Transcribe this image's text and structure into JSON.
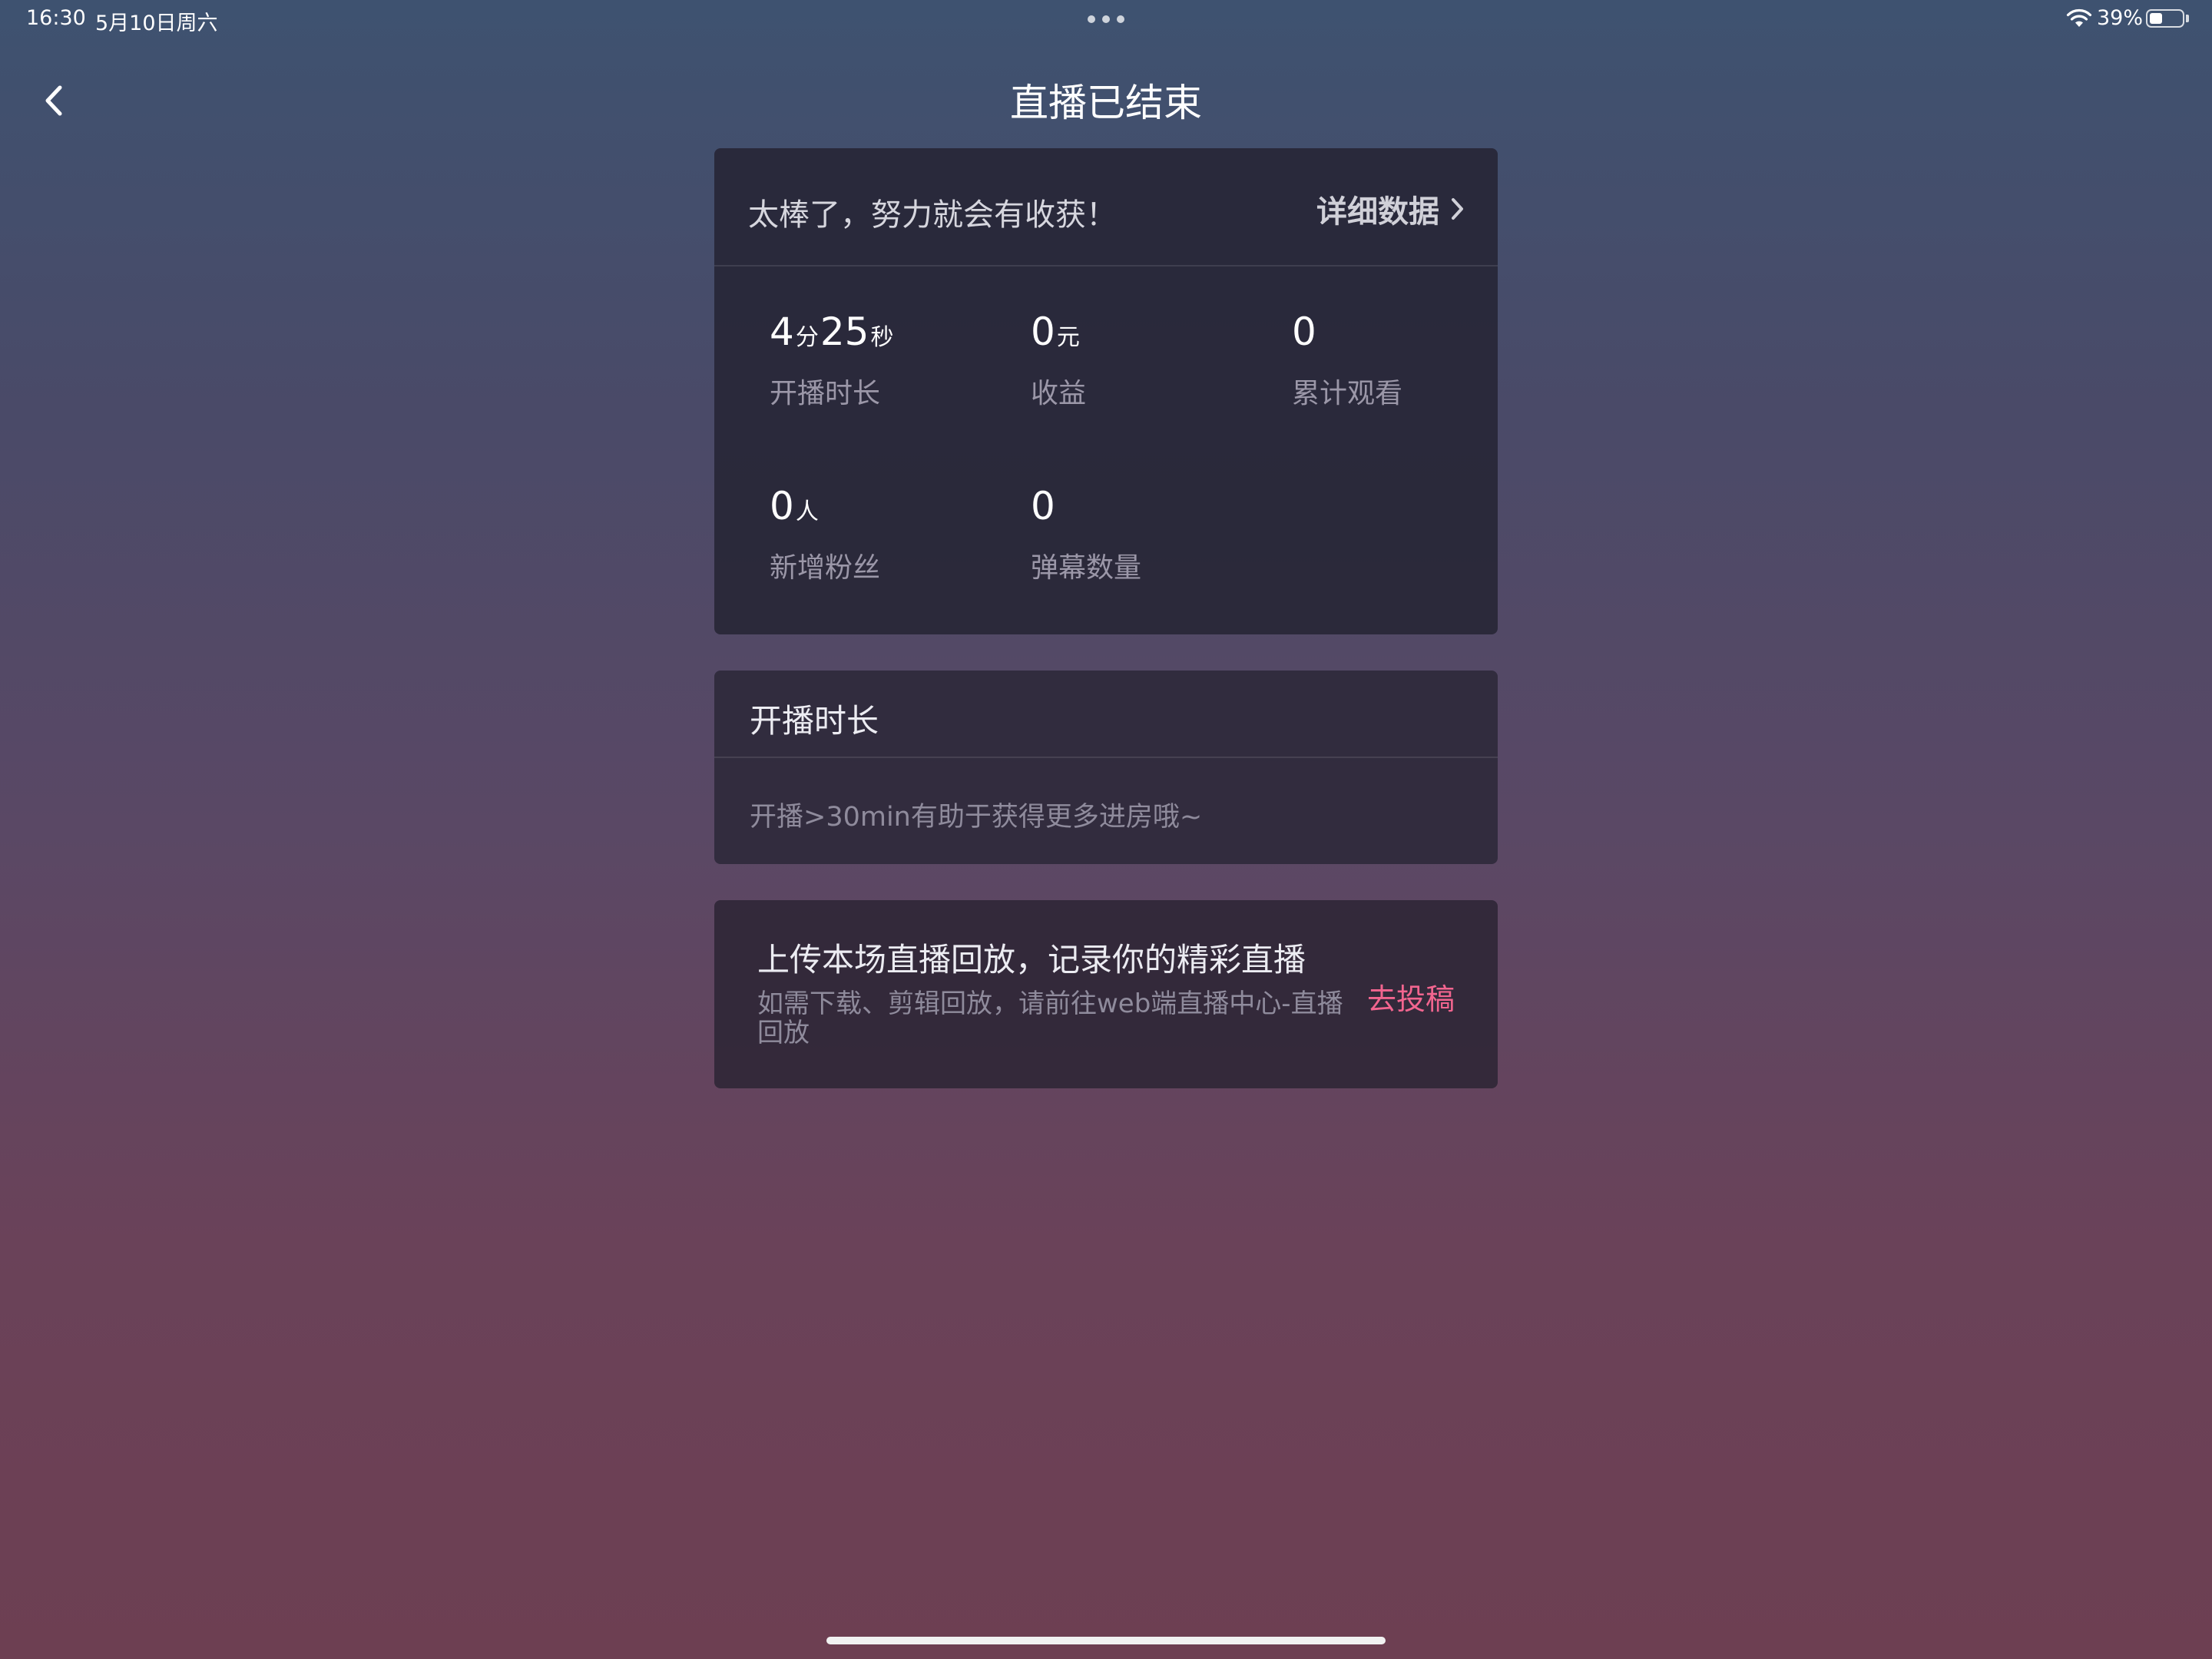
{
  "status_bar": {
    "time": "16:30",
    "date": "5月10日周六",
    "battery_percent": "39%",
    "battery_level": 0.39
  },
  "nav": {
    "title": "直播已结束",
    "back_icon": "chevron-left-icon"
  },
  "summary": {
    "encouragement": "太棒了，努力就会有收获！",
    "detail_link": "详细数据",
    "stats": [
      {
        "value": "4",
        "unit": "分",
        "value2": "25",
        "unit2": "秒",
        "label": "开播时长"
      },
      {
        "value": "0",
        "unit": "元",
        "label": "收益"
      },
      {
        "value": "0",
        "label": "累计观看"
      },
      {
        "value": "0",
        "unit": "人",
        "label": "新增粉丝"
      },
      {
        "value": "0",
        "label": "弹幕数量"
      }
    ]
  },
  "duration_card": {
    "title": "开播时长",
    "tip": "开播>30min有助于获得更多进房哦~"
  },
  "replay_card": {
    "title": "上传本场直播回放，记录你的精彩直播",
    "description": "如需下载、剪辑回放，请前往web端直播中心-直播回放",
    "action": "去投稿",
    "action_color": "#f2658f"
  }
}
